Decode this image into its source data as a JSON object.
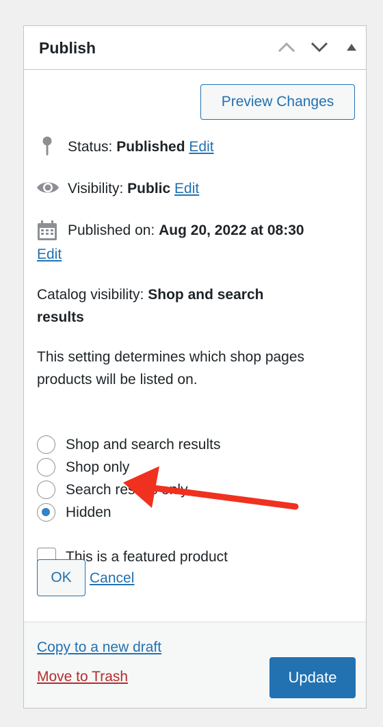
{
  "panel": {
    "title": "Publish",
    "header_icons": [
      "chevron-up-icon",
      "chevron-down-icon",
      "triangle-up-icon"
    ]
  },
  "preview_button": "Preview Changes",
  "status": {
    "label": "Status:",
    "value": "Published",
    "edit": "Edit",
    "icon": "pin-icon"
  },
  "visibility": {
    "label": "Visibility:",
    "value": "Public",
    "edit": "Edit",
    "icon": "eye-icon"
  },
  "published_on": {
    "label": "Published on:",
    "value": "Aug 20, 2022 at 08:30",
    "edit": "Edit",
    "icon": "calendar-icon"
  },
  "catalog": {
    "label": "Catalog visibility:",
    "value_line1": "Shop and search",
    "value_line2": "results",
    "description_line1": "This setting determines which shop pages",
    "description_line2": "products will be listed on.",
    "options": [
      {
        "label": "Shop and search results",
        "checked": false
      },
      {
        "label": "Shop only",
        "checked": false
      },
      {
        "label": "Search results only",
        "checked": false
      },
      {
        "label": "Hidden",
        "checked": true
      }
    ],
    "featured_label": "This is a featured product",
    "featured_checked": false,
    "ok": "OK",
    "cancel": "Cancel"
  },
  "footer": {
    "copy_draft": "Copy to a new draft",
    "trash": "Move to Trash",
    "update": "Update"
  },
  "colors": {
    "accent": "#2271b1",
    "danger": "#b32d2e",
    "annotation_arrow": "#f0311f",
    "radio_checked": "#3582c4"
  }
}
